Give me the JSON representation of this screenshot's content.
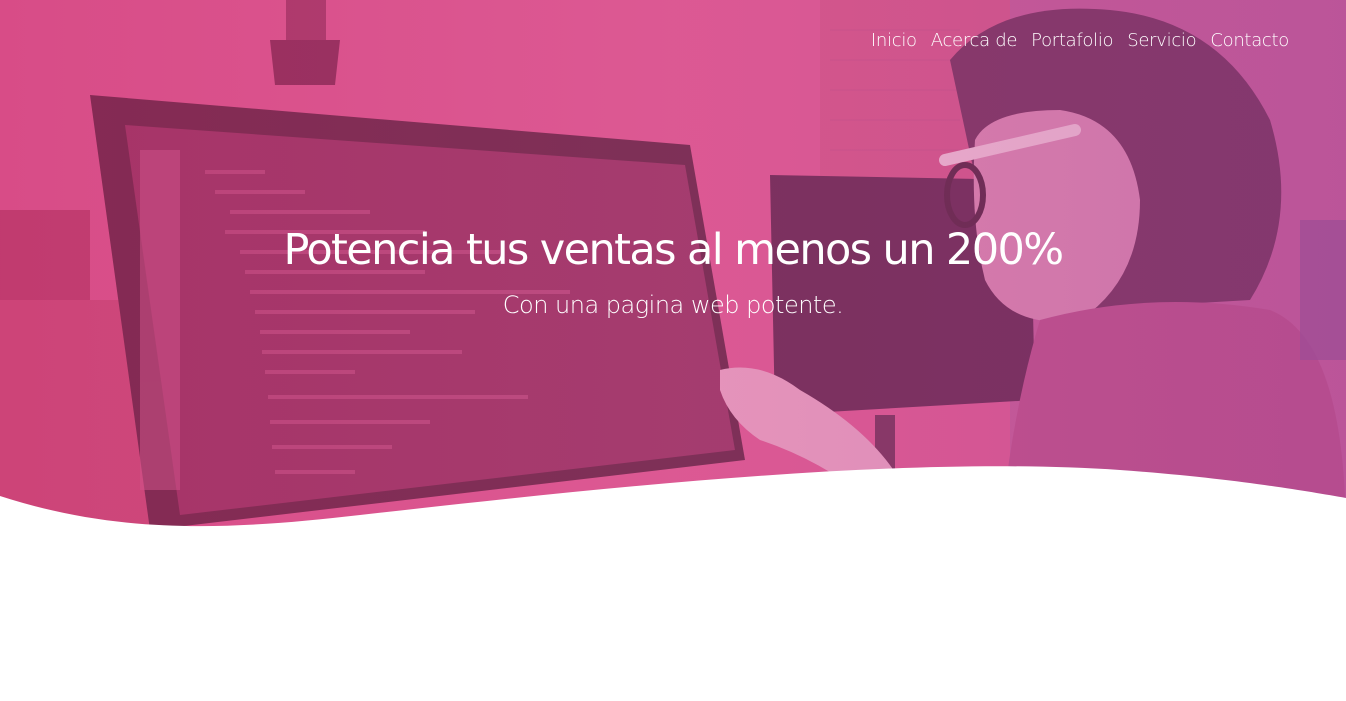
{
  "nav": {
    "items": [
      {
        "label": "Inicio"
      },
      {
        "label": "Acerca de"
      },
      {
        "label": "Portafolio"
      },
      {
        "label": "Servicio"
      },
      {
        "label": "Contacto"
      }
    ]
  },
  "hero": {
    "title": "Potencia tus ventas al menos un 200%",
    "subtitle": "Con una pagina web potente.",
    "overlay_color": "#e064a0"
  }
}
